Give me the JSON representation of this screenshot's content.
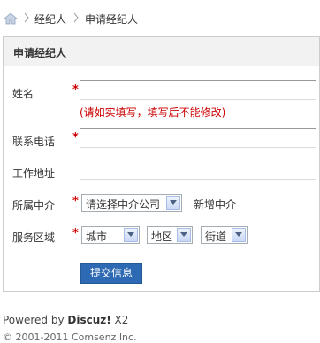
{
  "breadcrumb": {
    "items": [
      "经纪人",
      "申请经纪人"
    ]
  },
  "panel": {
    "title": "申请经纪人"
  },
  "form": {
    "name": {
      "label": "姓名",
      "value": "",
      "hint": "(请如实填写，填写后不能修改)"
    },
    "phone": {
      "label": "联系电话",
      "value": ""
    },
    "address": {
      "label": "工作地址",
      "value": ""
    },
    "agency": {
      "label": "所属中介",
      "selected": "请选择中介公司",
      "add_link": "新增中介"
    },
    "area": {
      "label": "服务区域",
      "city": "城市",
      "district": "地区",
      "street": "街道"
    },
    "required_mark": "*",
    "submit_label": "提交信息"
  },
  "footer": {
    "powered_prefix": "Powered by ",
    "brand": "Discuz!",
    "version": " X2",
    "copyright": "© 2001-2011 Comsenz Inc."
  },
  "colors": {
    "required": "#cc0000",
    "button": "#2e6ab3",
    "header_bg": "#f2f2f2"
  }
}
